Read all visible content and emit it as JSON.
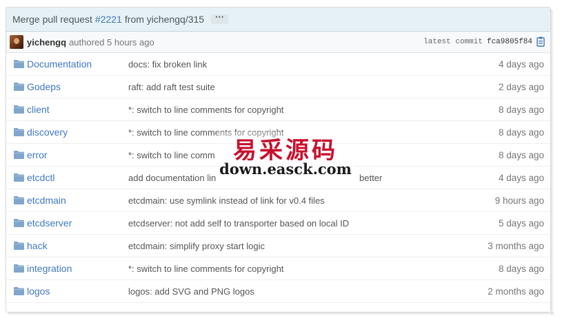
{
  "commit": {
    "prefix": "Merge pull request",
    "pr_number": "#2221",
    "suffix": "from yichengq/315",
    "more_label": "···"
  },
  "meta": {
    "author": "yichengq",
    "authored_text": "authored 5 hours ago",
    "latest_label": "latest commit",
    "sha": "fca9805f84"
  },
  "rows": [
    {
      "name": "Documentation",
      "message": "docs: fix broken link",
      "age": "4 days ago"
    },
    {
      "name": "Godeps",
      "message": "raft: add raft test suite",
      "age": "2 days ago"
    },
    {
      "name": "client",
      "message": "*: switch to line comments for copyright",
      "age": "8 days ago"
    },
    {
      "name": "discovery",
      "message": "*: switch to line comments for copyright",
      "age": "8 days ago"
    },
    {
      "name": "error",
      "message": "*: switch to line comm",
      "age": "8 days ago"
    },
    {
      "name": "etcdctl",
      "message": "add documentation lin",
      "message_tail": "better",
      "age": "4 days ago"
    },
    {
      "name": "etcdmain",
      "message": "etcdmain: use symlink instead of link for v0.4 files",
      "age": "9 hours ago"
    },
    {
      "name": "etcdserver",
      "message": "etcdserver: not add self to transporter based on local ID",
      "age": "5 days ago"
    },
    {
      "name": "hack",
      "message": "etcdmain: simplify proxy start logic",
      "age": "3 months ago"
    },
    {
      "name": "integration",
      "message": "*: switch to line comments for copyright",
      "age": "8 days ago"
    },
    {
      "name": "logos",
      "message": "logos: add SVG and PNG logos",
      "age": "2 months ago"
    }
  ],
  "watermark": {
    "chinese": "易采源码",
    "url": "down.easck.com"
  },
  "colors": {
    "link": "#4078c0",
    "commit_bar_bg": "#e6f1f6",
    "folder_icon": "#80a6cd",
    "watermark_red": "#c8102e"
  }
}
